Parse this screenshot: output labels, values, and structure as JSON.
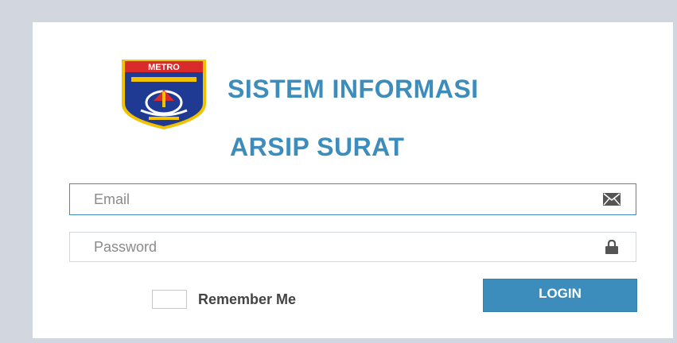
{
  "logo": {
    "banner_text": "METRO",
    "icon": "city-crest-icon",
    "colors": {
      "banner": "#d92b2b",
      "shield": "#1f3a93",
      "border": "#f2c200"
    }
  },
  "title": {
    "line1": "SISTEM INFORMASI",
    "line2": "ARSIP SURAT",
    "color": "#3c8dbc"
  },
  "form": {
    "email": {
      "placeholder": "Email",
      "value": "",
      "icon": "envelope-icon"
    },
    "password": {
      "placeholder": "Password",
      "value": "",
      "icon": "lock-icon"
    },
    "remember_label": "Remember Me",
    "remember_checked": false,
    "login_label": "LOGIN"
  },
  "colors": {
    "background": "#d2d6de",
    "accent": "#3c8dbc"
  }
}
